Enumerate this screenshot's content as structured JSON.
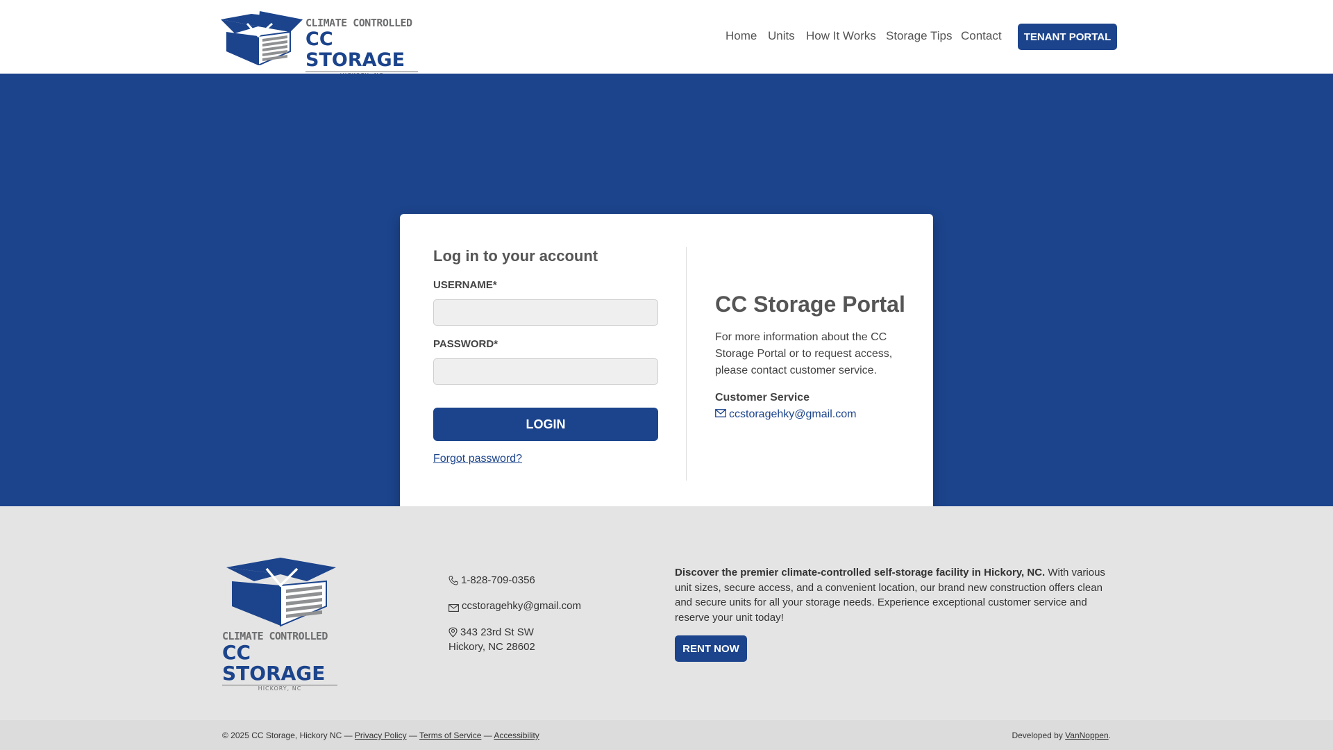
{
  "header": {
    "logo": {
      "line1": "CLIMATE CONTROLLED",
      "line2": "CC STORAGE",
      "line3": "HICKORY, NC"
    },
    "nav": [
      "Home",
      "Units",
      "How It Works",
      "Storage Tips",
      "Contact"
    ],
    "tenant_portal": "TENANT PORTAL"
  },
  "login": {
    "title": "Log in to your account",
    "username_label": "USERNAME*",
    "username_value": "",
    "password_label": "PASSWORD*",
    "password_value": "",
    "login_button": "LOGIN",
    "forgot_link": "Forgot password?"
  },
  "portal": {
    "title": "CC Storage Portal",
    "text": "For more information about the CC Storage Portal or to request access, please contact customer service.",
    "cs_title": "Customer Service",
    "cs_email": "ccstoragehky@gmail.com"
  },
  "footer": {
    "logo": {
      "line1": "CLIMATE CONTROLLED",
      "line2": "CC STORAGE",
      "line3": "HICKORY, NC"
    },
    "phone": "1-828-709-0356",
    "email": "ccstoragehky@gmail.com",
    "address_line1": "343 23rd St SW",
    "address_line2": "Hickory, NC 28602",
    "about_bold": "Discover the premier climate-controlled self-storage facility in Hickory, NC.",
    "about_text": " With various unit sizes, secure access, and a convenient location, our brand new construction offers clean and secure units for all your storage needs. Experience exceptional customer service and reserve your unit today!",
    "rent_now": "RENT NOW"
  },
  "bottom": {
    "copyright": "© 2025 CC Storage, Hickory NC — ",
    "privacy": "Privacy Policy",
    "sep1": " — ",
    "terms": "Terms of Service",
    "sep2": " — ",
    "accessibility": "Accessibility",
    "developed_by": "Developed by ",
    "developer": "VanNoppen",
    "period": "."
  },
  "colors": {
    "brand_blue": "#1c448c",
    "gray_text": "#6d6e70",
    "footer_bg": "#e4e4e4"
  },
  "icons": [
    "phone-icon",
    "envelope-icon",
    "map-pin-icon",
    "storage-box-icon"
  ]
}
